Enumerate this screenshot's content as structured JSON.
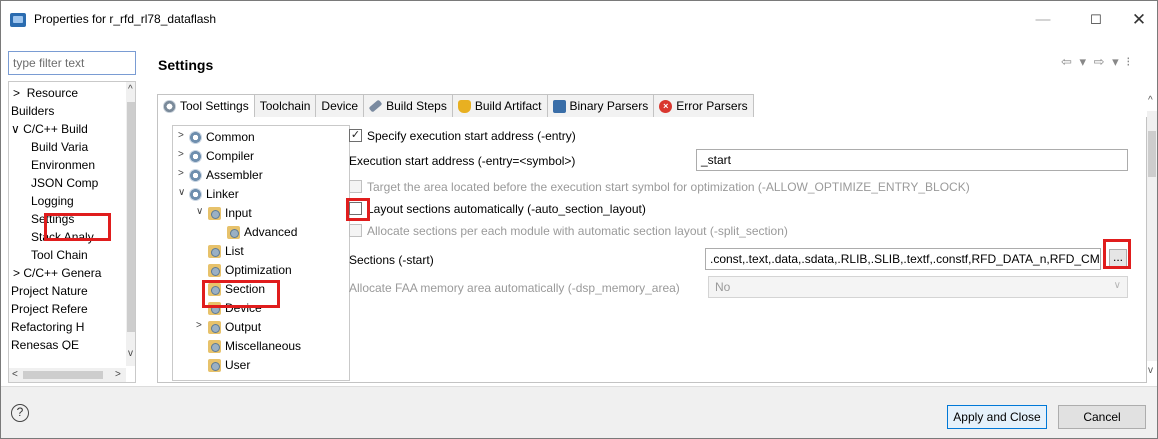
{
  "window": {
    "title": "Properties for r_rfd_rl78_dataflash",
    "minimize_glyph": "—",
    "maximize_glyph": "☐",
    "close_glyph": "✕"
  },
  "filter": {
    "placeholder": "type filter text"
  },
  "nav": {
    "items": [
      {
        "label": "Resource",
        "arrow": ">"
      },
      {
        "label": "Builders",
        "arrow": ""
      },
      {
        "label": "C/C++ Build",
        "arrow": "∨"
      },
      {
        "label": "Build Varia",
        "arrow": ""
      },
      {
        "label": "Environmen",
        "arrow": ""
      },
      {
        "label": "JSON Comp",
        "arrow": ""
      },
      {
        "label": "Logging",
        "arrow": ""
      },
      {
        "label": "Settings",
        "arrow": ""
      },
      {
        "label": "Stack Analy",
        "arrow": ""
      },
      {
        "label": "Tool Chain",
        "arrow": ""
      },
      {
        "label": "C/C++ Genera",
        "arrow": ">"
      },
      {
        "label": "Project Nature",
        "arrow": ""
      },
      {
        "label": "Project Refere",
        "arrow": ""
      },
      {
        "label": "Refactoring H",
        "arrow": ""
      },
      {
        "label": "Renesas QE",
        "arrow": ""
      }
    ],
    "scroll_up": "^",
    "scroll_down": "v",
    "scroll_left": "<",
    "scroll_right": ">"
  },
  "header": {
    "title": "Settings",
    "nav_arrows": "⇦ ▾ ⇨ ▾ ⁝"
  },
  "tabs": [
    {
      "label": "Tool Settings",
      "icon": "gear-icon"
    },
    {
      "label": "Toolchain",
      "icon": ""
    },
    {
      "label": "Device",
      "icon": ""
    },
    {
      "label": "Build Steps",
      "icon": "hammer-icon"
    },
    {
      "label": "Build Artifact",
      "icon": "trophy-icon"
    },
    {
      "label": "Binary Parsers",
      "icon": "binary-icon"
    },
    {
      "label": "Error Parsers",
      "icon": "error-icon"
    }
  ],
  "tool_tree": {
    "items": [
      {
        "label": "Common",
        "arrow": ">"
      },
      {
        "label": "Compiler",
        "arrow": ">"
      },
      {
        "label": "Assembler",
        "arrow": ">"
      },
      {
        "label": "Linker",
        "arrow": "∨"
      },
      {
        "label": "Input",
        "arrow": "∨"
      },
      {
        "label": "Advanced",
        "arrow": ""
      },
      {
        "label": "List",
        "arrow": ""
      },
      {
        "label": "Optimization",
        "arrow": ""
      },
      {
        "label": "Section",
        "arrow": ""
      },
      {
        "label": "Device",
        "arrow": ""
      },
      {
        "label": "Output",
        "arrow": ">"
      },
      {
        "label": "Miscellaneous",
        "arrow": ""
      },
      {
        "label": "User",
        "arrow": ""
      }
    ]
  },
  "options": {
    "entry_checkbox": {
      "label": "Specify execution start address (-entry)",
      "checked": true,
      "mark": "✓"
    },
    "entry_address": {
      "label": "Execution start address (-entry=<symbol>)",
      "value": "_start"
    },
    "allow_optimize": {
      "label": "Target the area located before the execution start symbol for optimization (-ALLOW_OPTIMIZE_ENTRY_BLOCK)"
    },
    "auto_section": {
      "label": "Layout sections automatically (-auto_section_layout)",
      "checked": false
    },
    "split_section": {
      "label": "Allocate sections per each module with automatic section layout (-split_section)"
    },
    "sections": {
      "label": "Sections (-start)",
      "value": ".const,.text,.data,.sdata,.RLIB,.SLIB,.textf,.constf,RFD_DATA_n,RFD_CMN",
      "browse_label": "..."
    },
    "dsp_memory": {
      "label": "Allocate FAA memory area automatically (-dsp_memory_area)",
      "value": "No",
      "caret": "∨"
    }
  },
  "scroll": {
    "up": "^",
    "down": "v"
  },
  "footer": {
    "help": "?",
    "apply": "Apply and Close",
    "cancel": "Cancel"
  },
  "colors": {
    "highlight": "#e01d1d",
    "accent": "#0078d7"
  }
}
